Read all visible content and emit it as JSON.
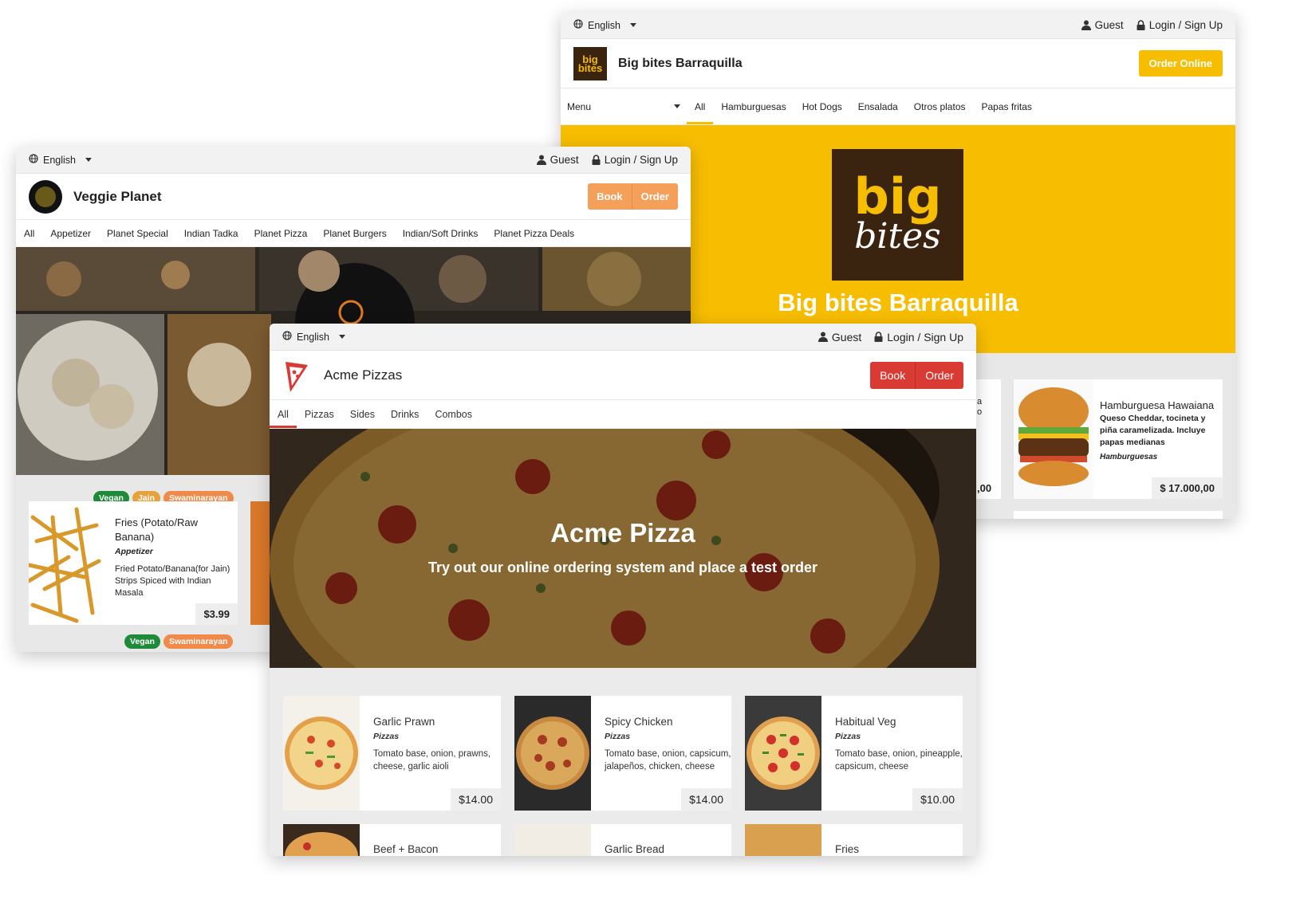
{
  "bigbites": {
    "language": "English",
    "guest": "Guest",
    "login": "Login / Sign Up",
    "name": "Big bites Barraquilla",
    "order_btn": "Order Online",
    "menu_select": "Menu",
    "nav": [
      "All",
      "Hamburguesas",
      "Hot Dogs",
      "Ensalada",
      "Otros platos",
      "Papas fritas"
    ],
    "hero_title": "Big bites Barraquilla",
    "card": {
      "title": "Hamburguesa Hawaiana",
      "desc": "Queso Cheddar, tocineta y piña caramelizada. Incluye papas medianas",
      "category": "Hamburguesas",
      "price": "$ 17.000,00"
    },
    "partial_text_a": "a",
    "partial_text_b": "o",
    "partial_price": ",00",
    "accent": "#f7bd00"
  },
  "veggie": {
    "language": "English",
    "guest": "Guest",
    "login": "Login / Sign Up",
    "name": "Veggie Planet",
    "book_btn": "Book",
    "order_btn": "Order",
    "nav": [
      "All",
      "Appetizer",
      "Planet Special",
      "Indian Tadka",
      "Planet Pizza",
      "Planet Burgers",
      "Indian/Soft Drinks",
      "Planet Pizza Deals"
    ],
    "card": {
      "badges": [
        "Vegan",
        "Jain",
        "Swaminarayan"
      ],
      "title": "Fries (Potato/Raw Banana)",
      "category": "Appetizer",
      "desc": "Fried Potato/Banana(for Jain) Strips Spiced with Indian Masala",
      "price": "$3.99"
    },
    "badges_row2": [
      "Vegan",
      "Swaminarayan"
    ],
    "accent": "#f5a05a"
  },
  "acme": {
    "language": "English",
    "guest": "Guest",
    "login": "Login / Sign Up",
    "name": "Acme Pizzas",
    "book_btn": "Book",
    "order_btn": "Order",
    "nav": [
      "All",
      "Pizzas",
      "Sides",
      "Drinks",
      "Combos"
    ],
    "hero_title": "Acme Pizza",
    "hero_subtitle": "Try out our online ordering system and place a test order",
    "cards": [
      {
        "title": "Garlic Prawn",
        "category": "Pizzas",
        "desc": "Tomato base, onion, prawns, cheese, garlic aioli",
        "price": "$14.00"
      },
      {
        "title": "Spicy Chicken",
        "category": "Pizzas",
        "desc": "Tomato base, onion, capsicum, jalapeños, chicken, cheese",
        "price": "$14.00"
      },
      {
        "title": "Habitual Veg",
        "category": "Pizzas",
        "desc": "Tomato base, onion, pineapple, capsicum, cheese",
        "price": "$10.00"
      }
    ],
    "row2": [
      "Beef + Bacon",
      "Garlic Bread",
      "Fries"
    ],
    "accent": "#d93a34"
  }
}
